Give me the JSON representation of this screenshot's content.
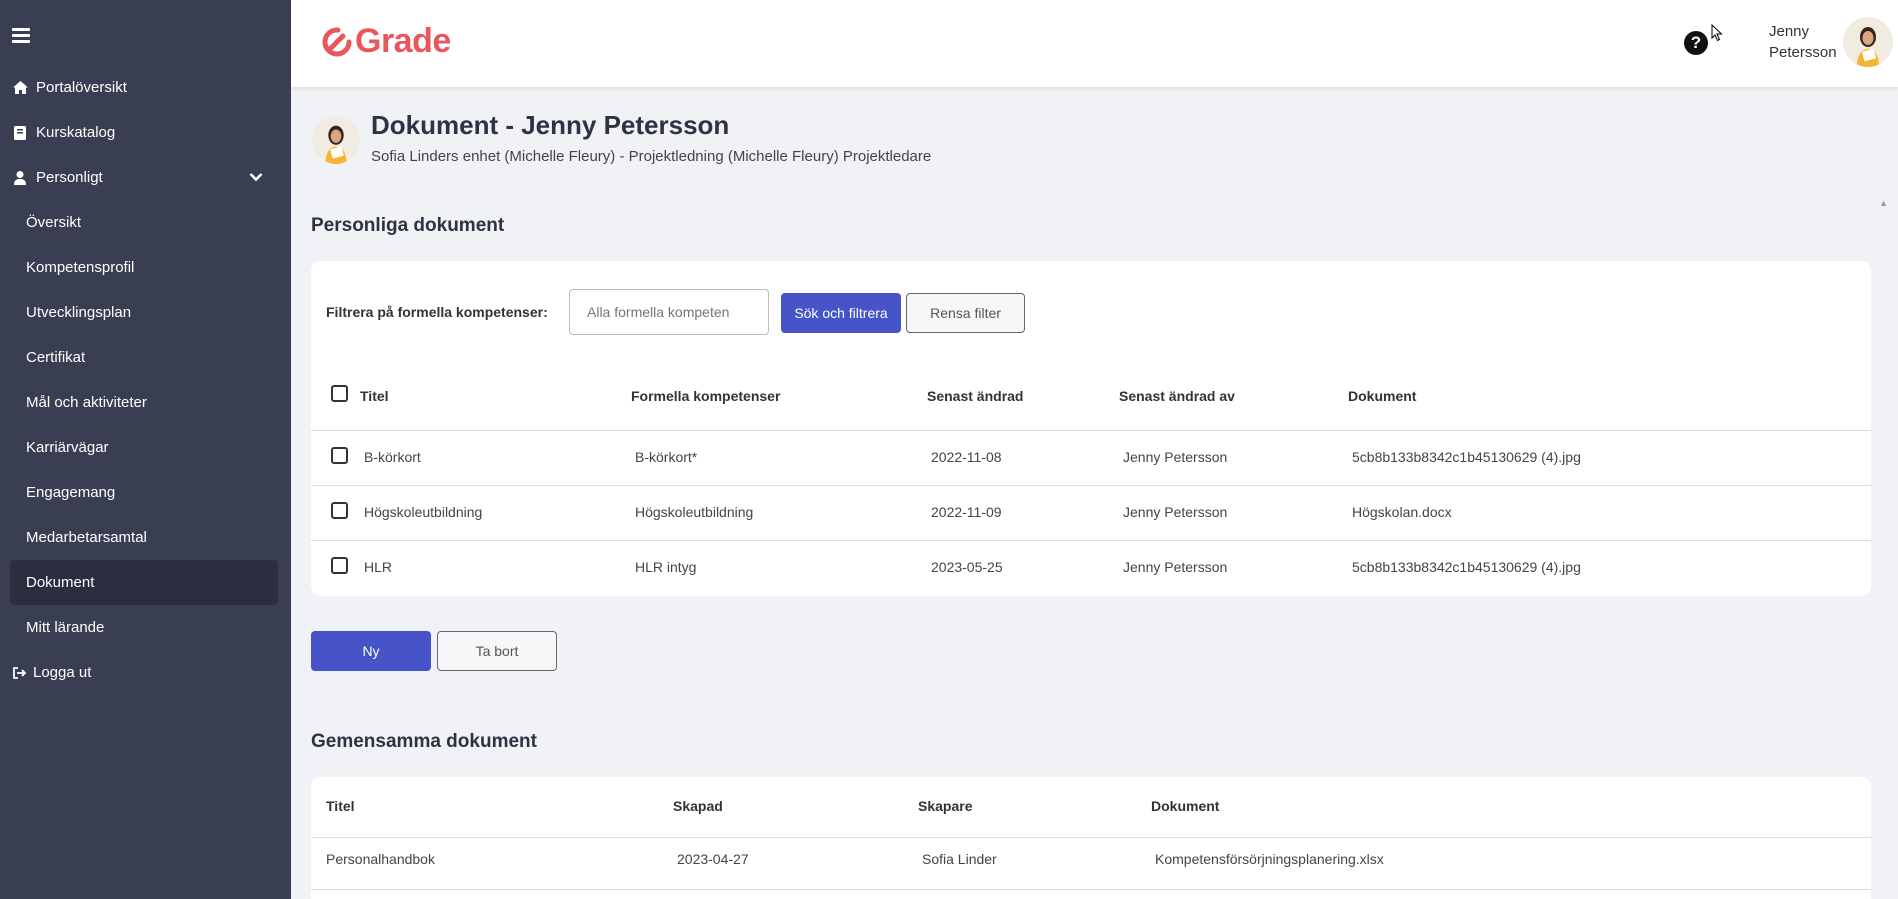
{
  "sidebar": {
    "items": [
      {
        "label": "Portalöversikt",
        "icon": "home-icon"
      },
      {
        "label": "Kurskatalog",
        "icon": "book-icon"
      },
      {
        "label": "Personligt",
        "icon": "user-icon"
      },
      {
        "label": "Översikt"
      },
      {
        "label": "Kompetensprofil"
      },
      {
        "label": "Utvecklingsplan"
      },
      {
        "label": "Certifikat"
      },
      {
        "label": "Mål och aktiviteter"
      },
      {
        "label": "Karriärvägar"
      },
      {
        "label": "Engagemang"
      },
      {
        "label": "Medarbetarsamtal"
      },
      {
        "label": "Dokument",
        "active": true
      },
      {
        "label": "Mitt lärande"
      },
      {
        "label": "Logga ut",
        "icon": "logout-icon"
      }
    ]
  },
  "header": {
    "logo_text": "Grade",
    "brand_color": "#e8575c",
    "help_icon": "question-circle-icon",
    "user_first": "Jenny",
    "user_last": "Petersson"
  },
  "page": {
    "title": "Dokument - Jenny Petersson",
    "subtitle": "Sofia Linders enhet (Michelle Fleury) - Projektledning (Michelle Fleury) Projektledare"
  },
  "personal": {
    "section_title": "Personliga dokument",
    "filter_label": "Filtrera på formella kompetenser:",
    "filter_placeholder": "Alla formella kompeten",
    "search_button": "Sök och filtrera",
    "clear_button": "Rensa filter",
    "columns": [
      "Titel",
      "Formella kompetenser",
      "Senast ändrad",
      "Senast ändrad av",
      "Dokument"
    ],
    "rows": [
      [
        "B-körkort",
        "B-körkort*",
        "2022-11-08",
        "Jenny Petersson",
        "5cb8b133b8342c1b45130629 (4).jpg"
      ],
      [
        "Högskoleutbildning",
        "Högskoleutbildning",
        "2022-11-09",
        "Jenny Petersson",
        "Högskolan.docx"
      ],
      [
        "HLR",
        "HLR intyg",
        "2023-05-25",
        "Jenny Petersson",
        "5cb8b133b8342c1b45130629 (4).jpg"
      ]
    ],
    "new_button": "Ny",
    "delete_button": "Ta bort",
    "accent_color": "#4654c8"
  },
  "shared": {
    "section_title": "Gemensamma dokument",
    "columns": [
      "Titel",
      "Skapad",
      "Skapare",
      "Dokument"
    ],
    "rows": [
      [
        "Personalhandbok",
        "2023-04-27",
        "Sofia Linder",
        "Kompetensförsörjningsplanering.xlsx"
      ]
    ]
  }
}
